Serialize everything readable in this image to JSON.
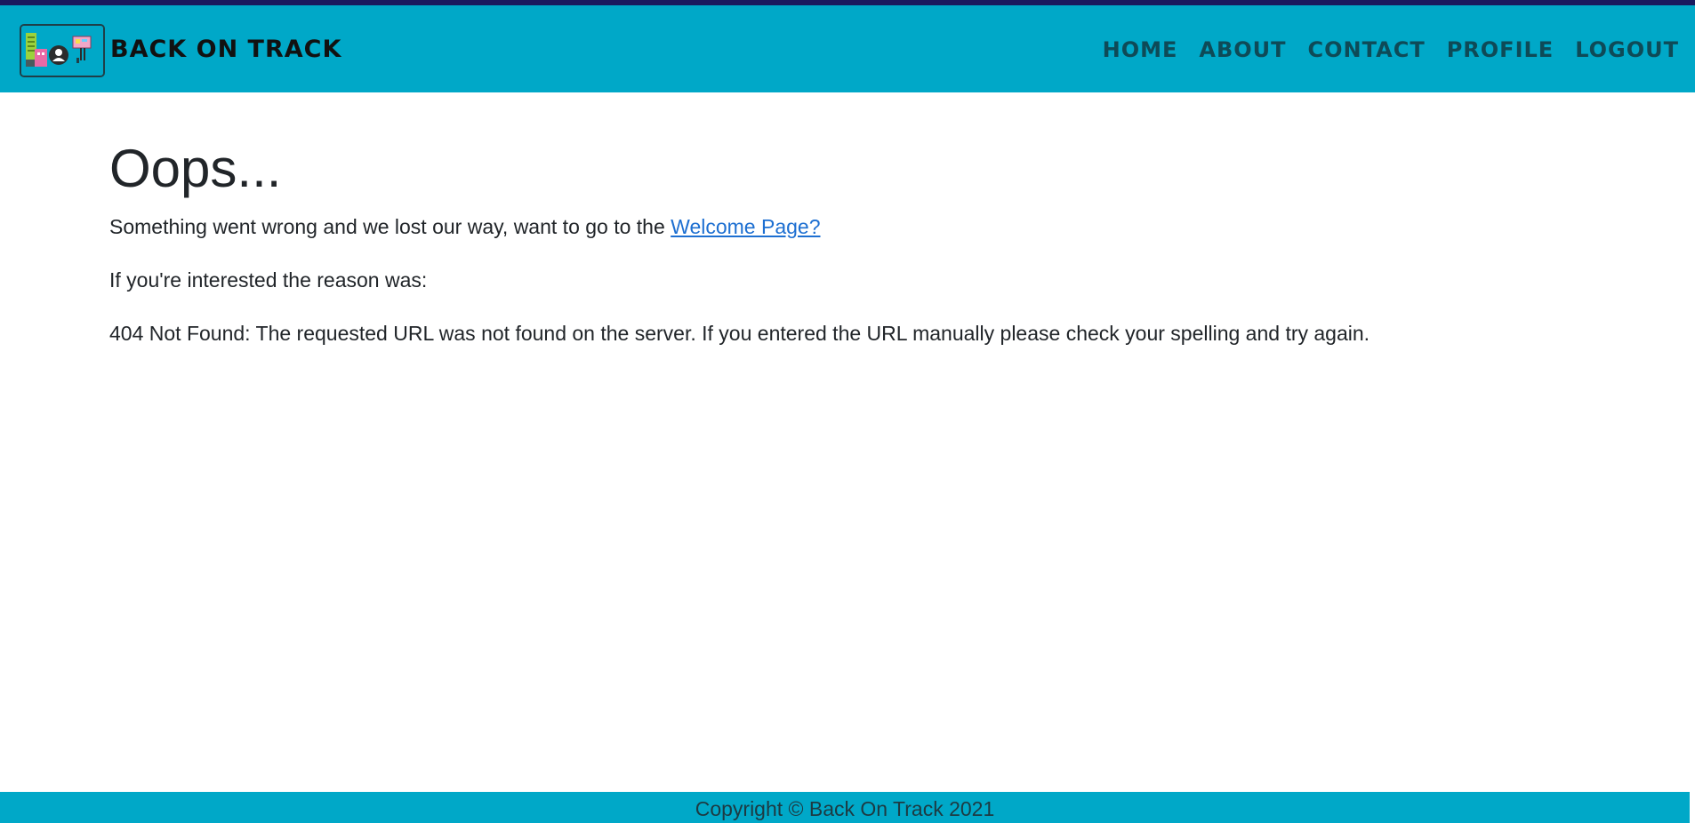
{
  "header": {
    "brand": "BACK ON TRACK",
    "logo_icon": "city-people-sign-logo",
    "nav": [
      "HOME",
      "ABOUT",
      "CONTACT",
      "PROFILE",
      "LOGOUT"
    ]
  },
  "main": {
    "title": "Oops...",
    "message_prefix": "Something went wrong and we lost our way, want to go to the ",
    "welcome_link": "Welcome Page?",
    "reason_intro": "If you're interested the reason was:",
    "reason": "404 Not Found: The requested URL was not found on the server. If you entered the URL manually please check your spelling and try again."
  },
  "footer": {
    "copyright": "Copyright © Back On Track 2021"
  },
  "colors": {
    "header_bg": "#00a8c8",
    "top_strip": "#1a1a5e",
    "link": "#1d6fd1",
    "text": "#212529"
  }
}
